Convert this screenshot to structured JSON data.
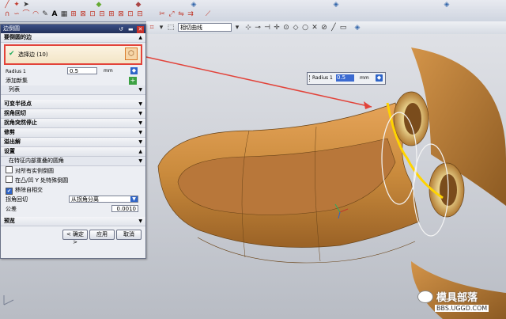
{
  "toolbar2": {
    "filter_value": "相切曲线"
  },
  "dialog": {
    "title": "边倒圆",
    "sections": {
      "edges_to_blend": "要倒圆的边",
      "select_edge": "选择边 (10)",
      "radius1_label": "Radius 1",
      "radius1_value": "0.5",
      "radius1_unit": "mm",
      "add_new_set": "添加新集",
      "list": "列表",
      "variable_radius": "可变半径点",
      "corner_setback": "拐角回切",
      "corner_stop": "拐角突然停止",
      "trim": "修剪",
      "overflow": "溢出解",
      "settings": "设置",
      "settings_option": "在特征内部重叠的圆角",
      "check_all_instances": "对所有实例倒圆",
      "convex_concave": "在凸/凹 Y 处特殊倒圆",
      "remove_self_intersection": "移除自相交",
      "corner_setback_label": "拐角回切",
      "corner_setback_value": "从拐角分离",
      "tolerance_label": "公差",
      "tolerance_value": "0.0010",
      "preview": "预览"
    },
    "buttons": {
      "ok": "< 确定 >",
      "apply": "应用",
      "cancel": "取消"
    }
  },
  "radius_popup": {
    "label": "Radius 1",
    "value": "0.5",
    "unit": "mm"
  },
  "watermark": {
    "brand": "模具部落",
    "url": "BBS.UGGD.COM"
  },
  "colors": {
    "part": "#c98a3c",
    "highlight": "#e2433a",
    "title_bar": "#2a3a6e"
  }
}
